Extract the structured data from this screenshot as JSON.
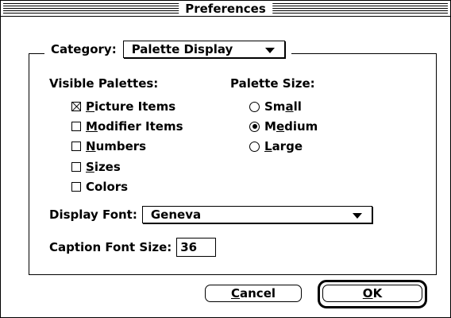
{
  "window": {
    "title": "Preferences"
  },
  "category": {
    "label": "Category:",
    "value": "Palette Display"
  },
  "visible_palettes": {
    "heading": "Visible Palettes:",
    "items": [
      {
        "label": "Picture Items",
        "mnemonic": "P",
        "checked": true
      },
      {
        "label": "Modifier Items",
        "mnemonic": "M",
        "checked": false
      },
      {
        "label": "Numbers",
        "mnemonic": "N",
        "checked": false
      },
      {
        "label": "Sizes",
        "mnemonic": "S",
        "checked": false
      },
      {
        "label": "Colors",
        "mnemonic": "",
        "checked": false
      }
    ]
  },
  "palette_size": {
    "heading": "Palette Size:",
    "options": [
      {
        "label": "Small",
        "mnemonic": "a",
        "selected": false
      },
      {
        "label": "Medium",
        "mnemonic": "e",
        "selected": true
      },
      {
        "label": "Large",
        "mnemonic": "L",
        "selected": false
      }
    ]
  },
  "display_font": {
    "label": "Display Font:",
    "value": "Geneva"
  },
  "caption_font_size": {
    "label": "Caption Font Size:",
    "value": "36"
  },
  "buttons": {
    "cancel": "Cancel",
    "ok": "OK"
  }
}
